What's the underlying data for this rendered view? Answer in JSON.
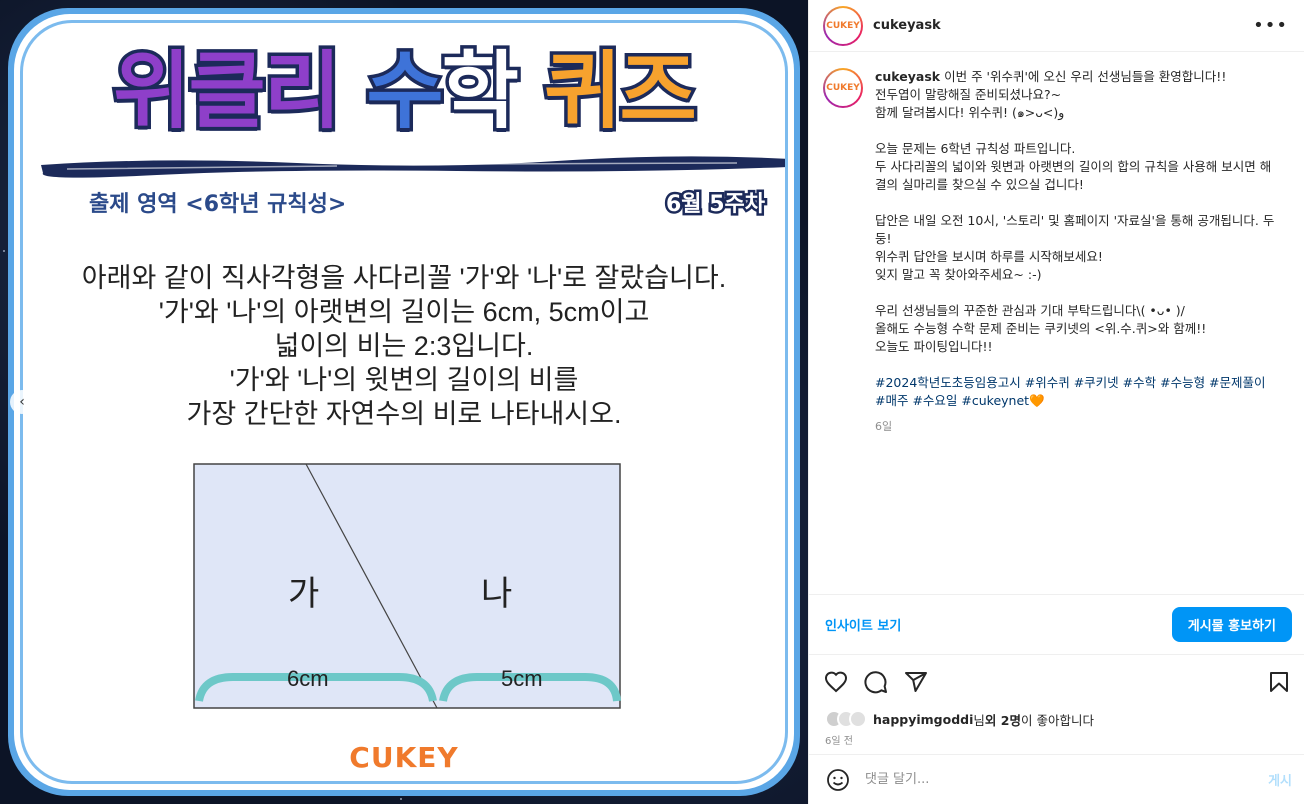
{
  "media": {
    "title_parts": [
      "위클리 ",
      "수",
      "학 ",
      "퀴즈"
    ],
    "topic": "출제 영역 <6학년 규칙성>",
    "week": "6월 5주차",
    "question_lines": [
      "아래와 같이 직사각형을 사다리꼴 '가'와 '나'로 잘랐습니다.",
      "'가'와 '나'의 아랫변의 길이는 6cm, 5cm이고",
      "넓이의 비는 2:3입니다.",
      "'가'와 '나'의 윗변의 길이의 비를",
      "가장 간단한 자연수의 비로 나타내시오."
    ],
    "diagram": {
      "label_a": "가",
      "label_b": "나",
      "len_a": "6cm",
      "len_b": "5cm"
    },
    "logo": "CUKEY",
    "prev_icon": "‹"
  },
  "header": {
    "avatar_text": "CUKEY",
    "username": "cukeyask",
    "more_icon": "•••"
  },
  "caption": {
    "username": "cukeyask",
    "paragraphs": [
      [
        "이번 주 '위수퀴'에 오신 우리 선생님들을 환영합니다!!",
        "전두엽이 말랑해질 준비되셨나요?~",
        "함께 달려봅시다! 위수퀴! (๑>ᴗ<)و"
      ],
      [
        "오늘 문제는 6학년 규칙성 파트입니다.",
        "두 사다리꼴의 넓이와 윗변과 아랫변의 길이의 합의 규칙을 사용해 보시면 해결의 실마리를 찾으실 수 있으실 겁니다!"
      ],
      [
        "답안은 내일 오전 10시, '스토리' 및 홈페이지 '자료실'을 통해 공개됩니다. 두둥!",
        "위수퀴 답안을 보시며 하루를 시작해보세요!",
        "잊지 말고 꼭 찾아와주세요~ :-)"
      ],
      [
        "우리 선생님들의 꾸준한 관심과 기대 부탁드립니다\\( •ᴗ• )/",
        "올해도 수능형 수학 문제 준비는 쿠키넷의 <위.수.퀴>와 함께!!",
        "오늘도 파이팅입니다!!"
      ]
    ],
    "tags": "#2024학년도초등임용고시 #위수퀴 #쿠키넷 #수학 #수능형 #문제풀이 #매주 #수요일 #cukeynet🧡",
    "ago": "6일"
  },
  "insight": {
    "link": "인사이트 보기",
    "button": "게시물 홍보하기"
  },
  "actions": {
    "like_icon": "heart-icon",
    "comment_icon": "comment-icon",
    "share_icon": "send-icon",
    "save_icon": "bookmark-icon"
  },
  "likes": {
    "user": "happyimgoddi",
    "mid": "님 ",
    "count": "외 2명",
    "tail": "이 좋아합니다"
  },
  "date": "6일 전",
  "comment": {
    "placeholder": "댓글 달기...",
    "post": "게시"
  }
}
